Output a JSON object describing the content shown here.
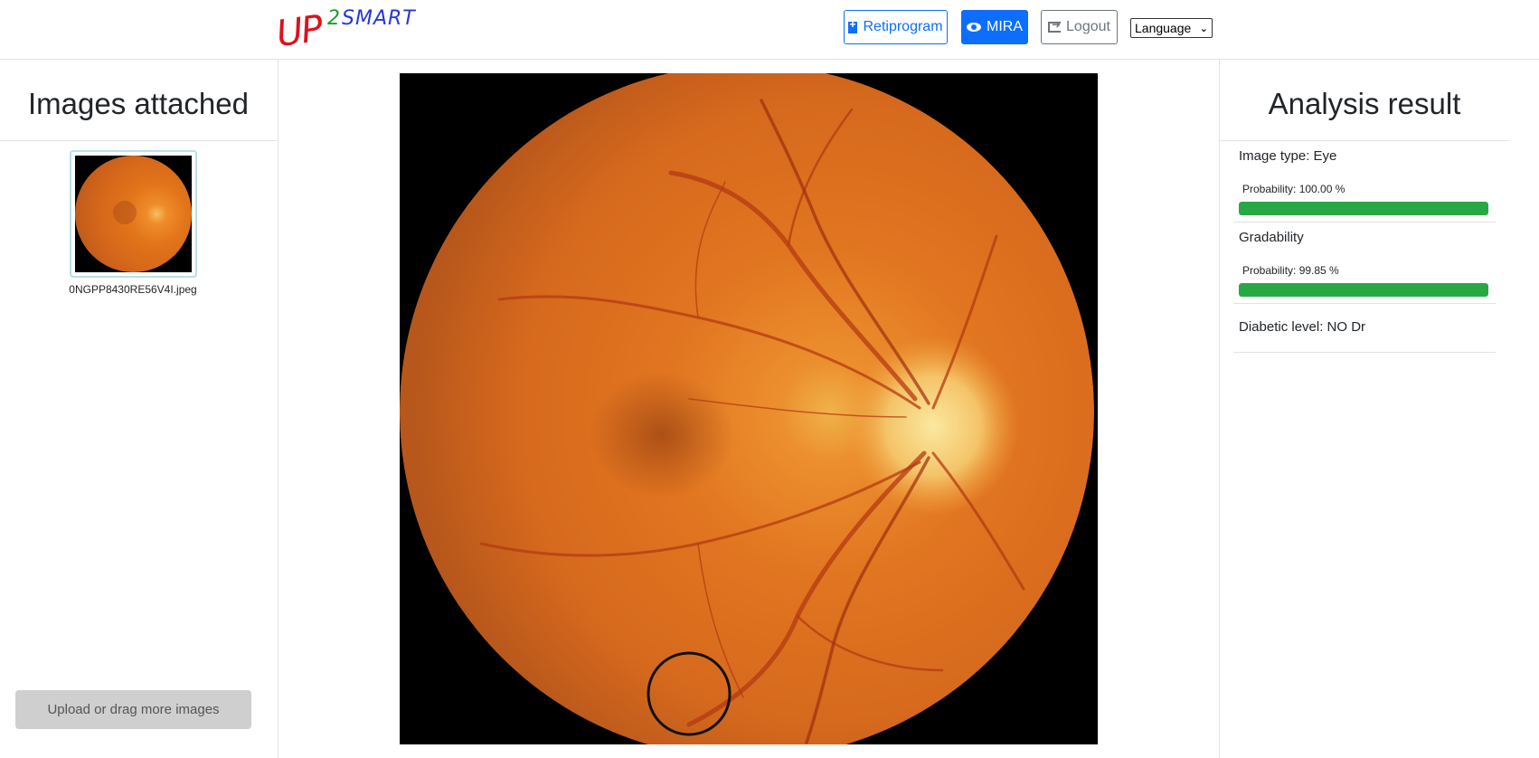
{
  "header": {
    "logo": {
      "up": "UP",
      "two": "2",
      "smart": "SMART"
    },
    "buttons": {
      "retiprogram": "Retiprogram",
      "mira": "MIRA",
      "logout": "Logout"
    },
    "language": {
      "selected": "Language"
    }
  },
  "left": {
    "title": "Images attached",
    "images": [
      {
        "filename": "0NGPP8430RE56V4I.jpeg"
      }
    ],
    "upload_label": "Upload or drag more images"
  },
  "right": {
    "title": "Analysis result",
    "results": [
      {
        "label": "Image type: Eye",
        "prob_label": "Probability: 100.00 %",
        "probability": 100.0
      },
      {
        "label": "Gradability",
        "prob_label": "Probability: 99.85 %",
        "probability": 99.85
      },
      {
        "label": "Diabetic level: NO Dr"
      }
    ]
  },
  "colors": {
    "primary": "#0d6efd",
    "success": "#28a745",
    "secondary": "#6c757d"
  }
}
